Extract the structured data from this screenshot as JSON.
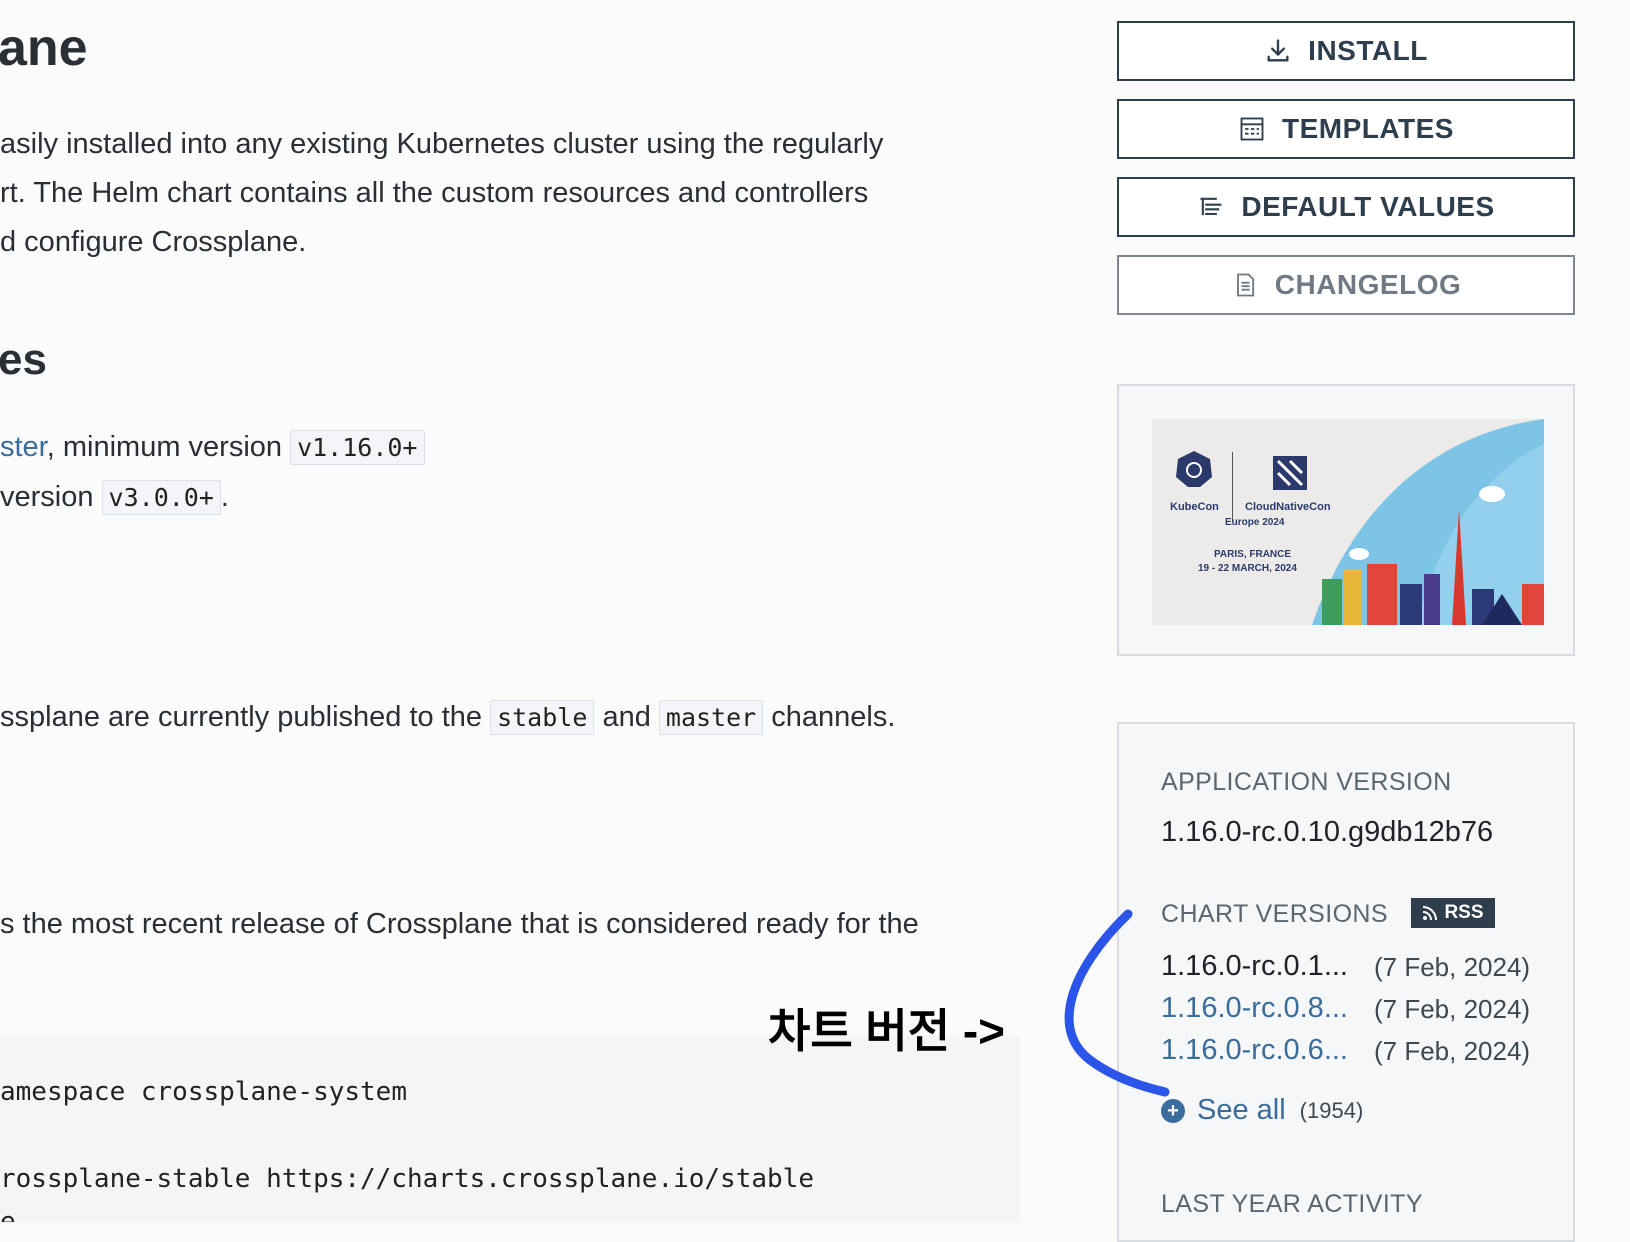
{
  "main": {
    "title_fragment": "ane",
    "intro_lines": [
      "asily installed into any existing Kubernetes cluster using the regularly",
      "rt. The Helm chart contains all the custom resources and controllers",
      "d configure Crossplane."
    ],
    "prereq_heading_fragment": "es",
    "prereq_line1": {
      "link": "ster",
      "text": ", minimum version ",
      "code": "v1.16.0+"
    },
    "prereq_line2": {
      "text": " version ",
      "code": "v3.0.0+",
      "end": "."
    },
    "channels_line": {
      "pre": "ssplane are currently published to the ",
      "code1": "stable",
      "mid": " and ",
      "code2": "master",
      "post": " channels."
    },
    "stable_line": "s the most recent release of Crossplane that is considered ready for the",
    "code_lines": [
      "amespace crossplane-system",
      "rossplane-stable https://charts.crossplane.io/stable",
      "e"
    ],
    "annotation": "차트 버전 ->"
  },
  "sidebar": {
    "buttons": [
      {
        "label": "INSTALL",
        "icon": "download-icon"
      },
      {
        "label": "TEMPLATES",
        "icon": "templates-icon"
      },
      {
        "label": "DEFAULT VALUES",
        "icon": "list-icon"
      },
      {
        "label": "CHANGELOG",
        "icon": "document-icon"
      }
    ],
    "banner": {
      "kubecon": "KubeCon",
      "cloudnative": "CloudNativeCon",
      "edition": "Europe 2024",
      "location": "PARIS, FRANCE",
      "dates": "19 - 22 MARCH, 2024"
    },
    "app_version_label": "APPLICATION VERSION",
    "app_version": "1.16.0-rc.0.10.g9db12b76",
    "chart_versions_label": "CHART VERSIONS",
    "rss_label": "RSS",
    "versions": [
      {
        "version": "1.16.0-rc.0.1...",
        "date": "(7 Feb, 2024)"
      },
      {
        "version": "1.16.0-rc.0.8...",
        "date": "(7 Feb, 2024)"
      },
      {
        "version": "1.16.0-rc.0.6...",
        "date": "(7 Feb, 2024)"
      }
    ],
    "see_all_label": "See all",
    "see_all_count": "(1954)",
    "last_year_label": "LAST YEAR ACTIVITY"
  },
  "colors": {
    "accent": "#2f3e4c",
    "link": "#3a6d9c",
    "annotation_stroke": "#2b55e8"
  }
}
